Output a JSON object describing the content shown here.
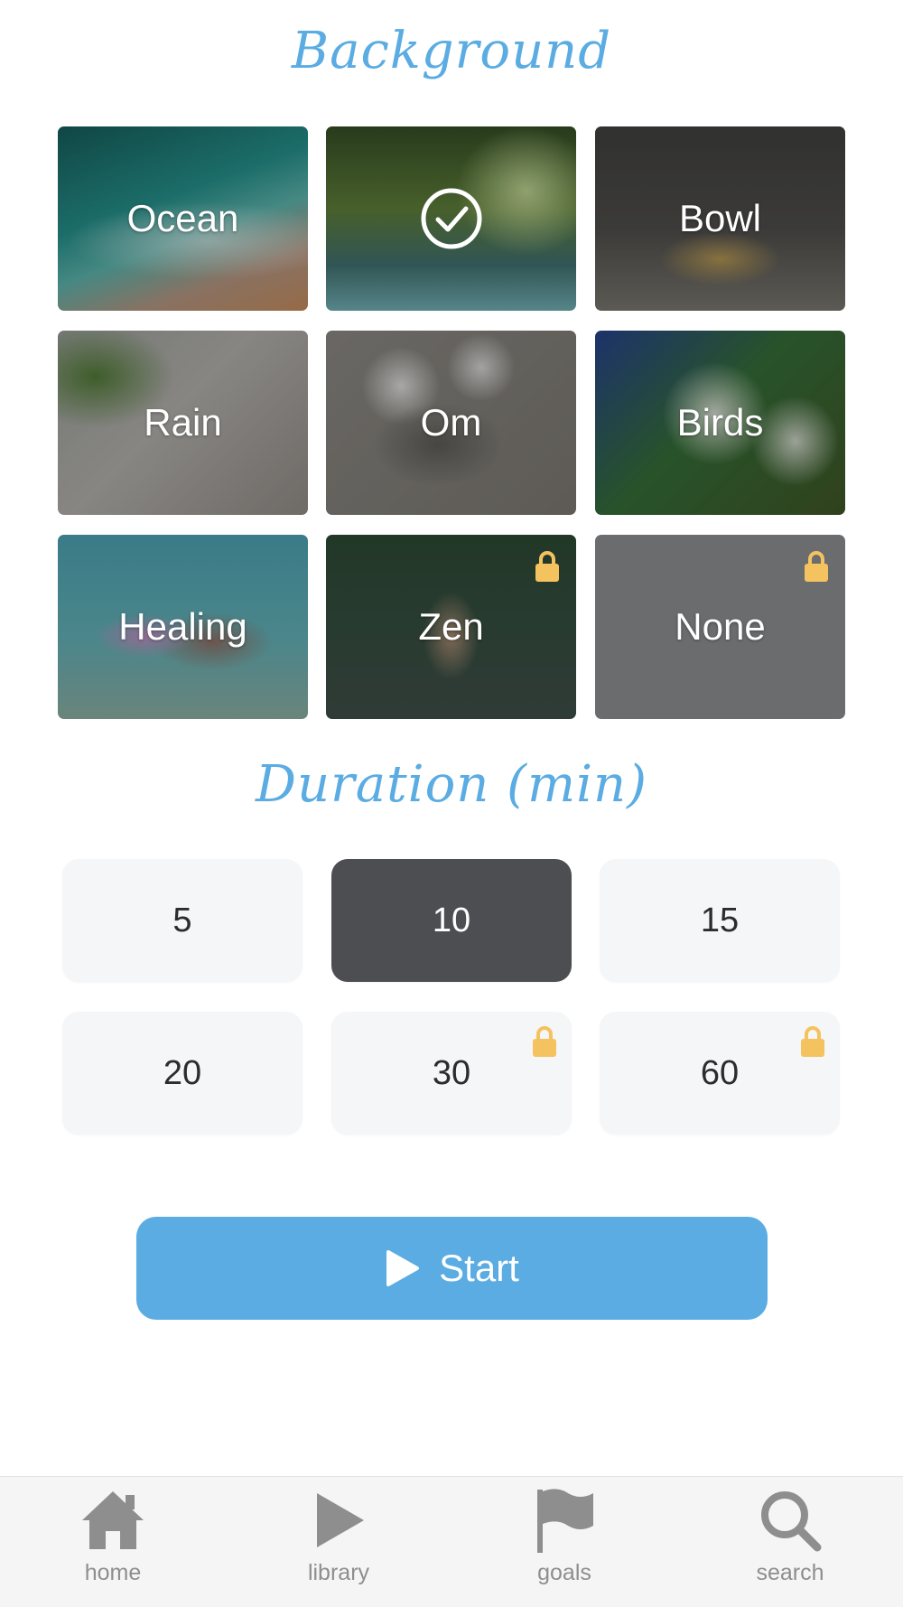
{
  "background_section": {
    "title": "Background",
    "tiles": [
      {
        "label": "Ocean"
      },
      {
        "label": "",
        "selected": true
      },
      {
        "label": "Bowl"
      },
      {
        "label": "Rain"
      },
      {
        "label": "Om"
      },
      {
        "label": "Birds"
      },
      {
        "label": "Healing"
      },
      {
        "label": "Zen",
        "locked": true
      },
      {
        "label": "None",
        "locked": true
      }
    ]
  },
  "duration_section": {
    "title": "Duration (min)",
    "options": [
      {
        "label": "5"
      },
      {
        "label": "10",
        "selected": true
      },
      {
        "label": "15"
      },
      {
        "label": "20"
      },
      {
        "label": "30",
        "locked": true
      },
      {
        "label": "60",
        "locked": true
      }
    ]
  },
  "start_button": {
    "label": "Start",
    "icon": "play-icon"
  },
  "nav": [
    {
      "label": "home",
      "icon": "home-icon"
    },
    {
      "label": "library",
      "icon": "play-icon"
    },
    {
      "label": "goals",
      "icon": "flag-icon"
    },
    {
      "label": "search",
      "icon": "search-icon"
    }
  ],
  "colors": {
    "accent": "#5aace2",
    "lock": "#f5c260",
    "selected_duration": "#4d4e52",
    "nav_icon": "#8e8e8e"
  }
}
